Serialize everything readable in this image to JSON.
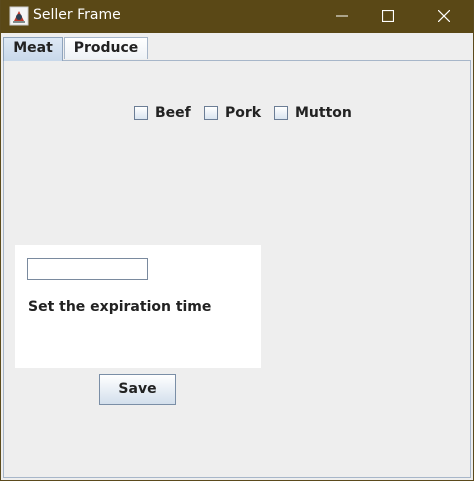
{
  "window": {
    "title": "Seller Frame",
    "titlebar_color": "#5a4816",
    "icons": [
      "java-app-icon",
      "minimize-icon",
      "maximize-icon",
      "close-icon"
    ]
  },
  "tabs": [
    {
      "label": "Meat",
      "selected": true
    },
    {
      "label": "Produce",
      "selected": false
    }
  ],
  "meat_panel": {
    "checkboxes": [
      {
        "label": "Beef",
        "checked": false
      },
      {
        "label": "Pork",
        "checked": false
      },
      {
        "label": "Mutton",
        "checked": false
      }
    ],
    "expiration": {
      "value": "",
      "label": "Set the expiration time"
    },
    "save_label": "Save"
  }
}
